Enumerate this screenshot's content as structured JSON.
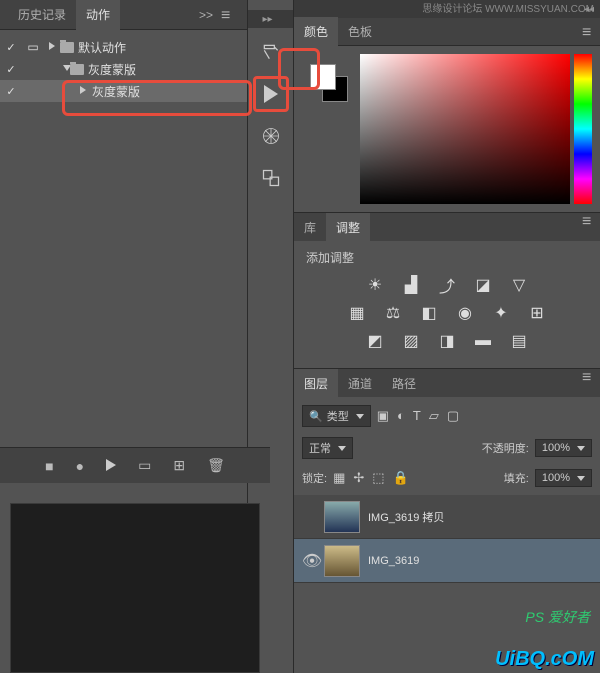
{
  "watermark_top": "思缘设计论坛 WWW.MISSYUAN.COM",
  "left_panel": {
    "tabs": {
      "history": "历史记录",
      "actions": "动作"
    },
    "expand_symbol": ">>",
    "tree": {
      "row0": {
        "check": "✓",
        "label": "默认动作"
      },
      "row1": {
        "check": "✓",
        "label": "灰度蒙版"
      },
      "row2": {
        "check": "✓",
        "label": "灰度蒙版"
      }
    },
    "bottom_icons": {
      "stop": "■",
      "record": "●",
      "play": "▶",
      "new_set": "▭",
      "new_action": "⊞",
      "trash": "🗑"
    }
  },
  "mid_tools": {
    "t0": "brush-history-icon",
    "t1": "play-icon",
    "t2": "wheel-icon",
    "t3": "shapes-icon"
  },
  "color_panel": {
    "tabs": {
      "color": "颜色",
      "swatches": "色板"
    }
  },
  "adjust_panel": {
    "tabs": {
      "lib": "库",
      "adjust": "调整"
    },
    "add_label": "添加调整"
  },
  "layers_panel": {
    "tabs": {
      "layers": "图层",
      "channels": "通道",
      "paths": "路径"
    },
    "filter_type": "类型",
    "blend_mode": "正常",
    "opacity_label": "不透明度:",
    "opacity_value": "100%",
    "lock_label": "锁定:",
    "fill_label": "填充:",
    "fill_value": "100%",
    "layers": {
      "l0": {
        "name": "IMG_3619 拷贝"
      },
      "l1": {
        "name": "IMG_3619"
      }
    }
  },
  "watermark_green": "PS 爱好者",
  "watermark_bottom": "UiBQ.cOM"
}
